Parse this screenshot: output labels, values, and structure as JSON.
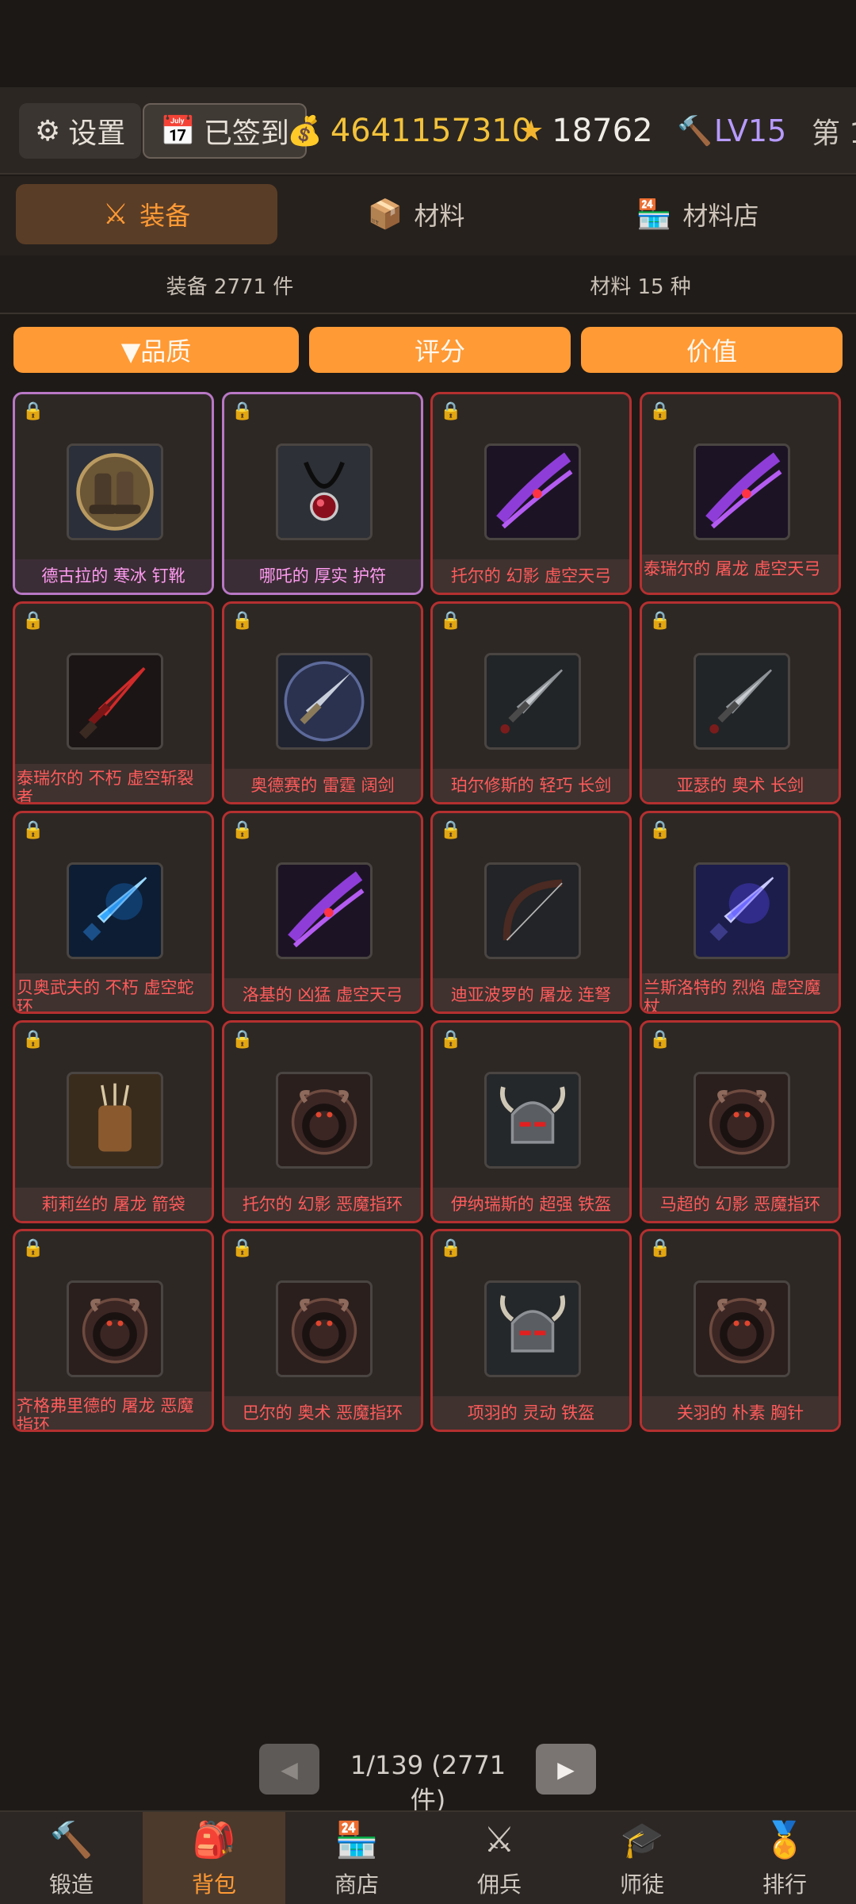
{
  "topbar": {
    "settings_label": "设置",
    "signed_label": "已签到",
    "gold": "4641157310",
    "stars": "18762",
    "level": "LV15",
    "rank_prefix": "第 1"
  },
  "tabs": [
    {
      "icon": "⚔",
      "label": "装备",
      "active": true
    },
    {
      "icon": "📦",
      "label": "材料",
      "active": false
    },
    {
      "icon": "🏪",
      "label": "材料店",
      "active": false
    }
  ],
  "counts": {
    "equipment": "装备 2771 件",
    "materials": "材料 15 种"
  },
  "sort": {
    "quality": "▼品质",
    "score": "评分",
    "value": "价值"
  },
  "items": [
    {
      "name": "德古拉的 寒冰 钉靴",
      "quality": "purple",
      "art": "boots"
    },
    {
      "name": "哪吒的 厚实 护符",
      "quality": "purple",
      "art": "amulet"
    },
    {
      "name": "托尔的 幻影 虚空天弓",
      "quality": "red",
      "art": "voidbow"
    },
    {
      "name": "泰瑞尔的 屠龙 虚空天弓",
      "quality": "red",
      "art": "voidbow"
    },
    {
      "name": "泰瑞尔的 不朽 虚空斩裂者",
      "quality": "red",
      "art": "redsword"
    },
    {
      "name": "奥德赛的 雷霆 阔剑",
      "quality": "red",
      "art": "broadsword"
    },
    {
      "name": "珀尔修斯的 轻巧 长剑",
      "quality": "red",
      "art": "longsword"
    },
    {
      "name": "亚瑟的 奥术 长剑",
      "quality": "red",
      "art": "longsword"
    },
    {
      "name": "贝奥武夫的 不朽 虚空蛇环",
      "quality": "red",
      "art": "bluesword"
    },
    {
      "name": "洛基的 凶猛 虚空天弓",
      "quality": "red",
      "art": "voidbow"
    },
    {
      "name": "迪亚波罗的 屠龙 连弩",
      "quality": "red",
      "art": "bow"
    },
    {
      "name": "兰斯洛特的 烈焰 虚空魔杖",
      "quality": "red",
      "art": "bluesword2"
    },
    {
      "name": "莉莉丝的 屠龙 箭袋",
      "quality": "red",
      "art": "quiver"
    },
    {
      "name": "托尔的 幻影 恶魔指环",
      "quality": "red",
      "art": "ring"
    },
    {
      "name": "伊纳瑞斯的 超强 铁盔",
      "quality": "red",
      "art": "helm"
    },
    {
      "name": "马超的 幻影 恶魔指环",
      "quality": "red",
      "art": "ring"
    },
    {
      "name": "齐格弗里德的 屠龙 恶魔指环",
      "quality": "red",
      "art": "ring"
    },
    {
      "name": "巴尔的 奥术 恶魔指环",
      "quality": "red",
      "art": "ring"
    },
    {
      "name": "项羽的 灵动 铁盔",
      "quality": "red",
      "art": "helm"
    },
    {
      "name": "关羽的 朴素 胸针",
      "quality": "red",
      "art": "ring"
    }
  ],
  "pager": {
    "text": "1/139 (2771件)",
    "prev": "◀",
    "next": "▶"
  },
  "nav": [
    {
      "icon": "🔨",
      "label": "锻造",
      "active": false
    },
    {
      "icon": "🎒",
      "label": "背包",
      "active": true
    },
    {
      "icon": "🏪",
      "label": "商店",
      "active": false
    },
    {
      "icon": "⚔",
      "label": "佣兵",
      "active": false
    },
    {
      "icon": "🎓",
      "label": "师徒",
      "active": false
    },
    {
      "icon": "🏅",
      "label": "排行",
      "active": false
    }
  ]
}
